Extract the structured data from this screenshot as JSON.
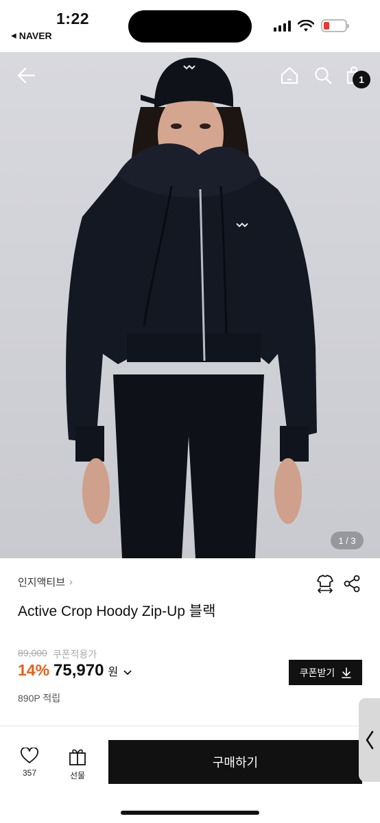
{
  "status_bar": {
    "time": "1:22",
    "back_app": "NAVER",
    "battery_color": "#e53935"
  },
  "hero": {
    "pager": "1 / 3",
    "cart_count": "1",
    "icons": [
      "back-arrow-icon",
      "home-icon",
      "search-icon",
      "cart-icon"
    ]
  },
  "product": {
    "brand": "인지액티브",
    "title": "Active Crop Hoody Zip-Up 블랙",
    "original_price": "89,000",
    "coupon_label": "쿠폰적용가",
    "discount": "14%",
    "price": "75,970",
    "currency": "원",
    "points": "890P 적립",
    "coupon_button": "쿠폰받기"
  },
  "bottom_bar": {
    "like_count": "357",
    "gift_label": "선물",
    "buy_label": "구매하기"
  },
  "colors": {
    "accent": "#e2611c",
    "primary": "#111111"
  }
}
